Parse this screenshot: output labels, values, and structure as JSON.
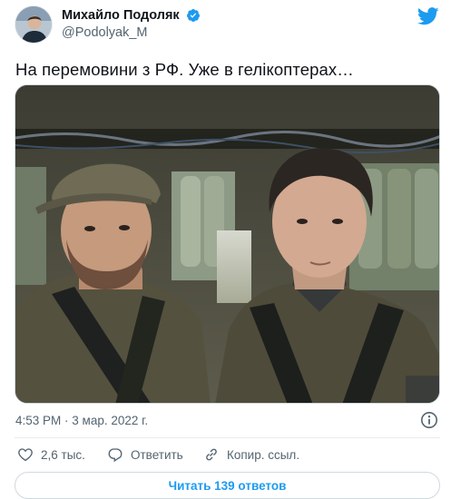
{
  "colors": {
    "accent": "#1d9bf0",
    "text_primary": "#0f1419",
    "text_secondary": "#536471",
    "border": "#cfd9de"
  },
  "author": {
    "display_name": "Михайло Подоляк",
    "handle": "@Podolyak_M",
    "verified": true,
    "avatar_icon": "avatar"
  },
  "brand_icon": "twitter-bird-icon",
  "tweet": {
    "text": "На перемовини з РФ. Уже в гелікоптерах…",
    "timestamp": "4:53 PM · 3 мар. 2022 г."
  },
  "actions": {
    "likes": "2,6 тыс.",
    "reply_label": "Ответить",
    "copy_link_label": "Копир. ссыл."
  },
  "read_replies_label": "Читать 139 ответов"
}
